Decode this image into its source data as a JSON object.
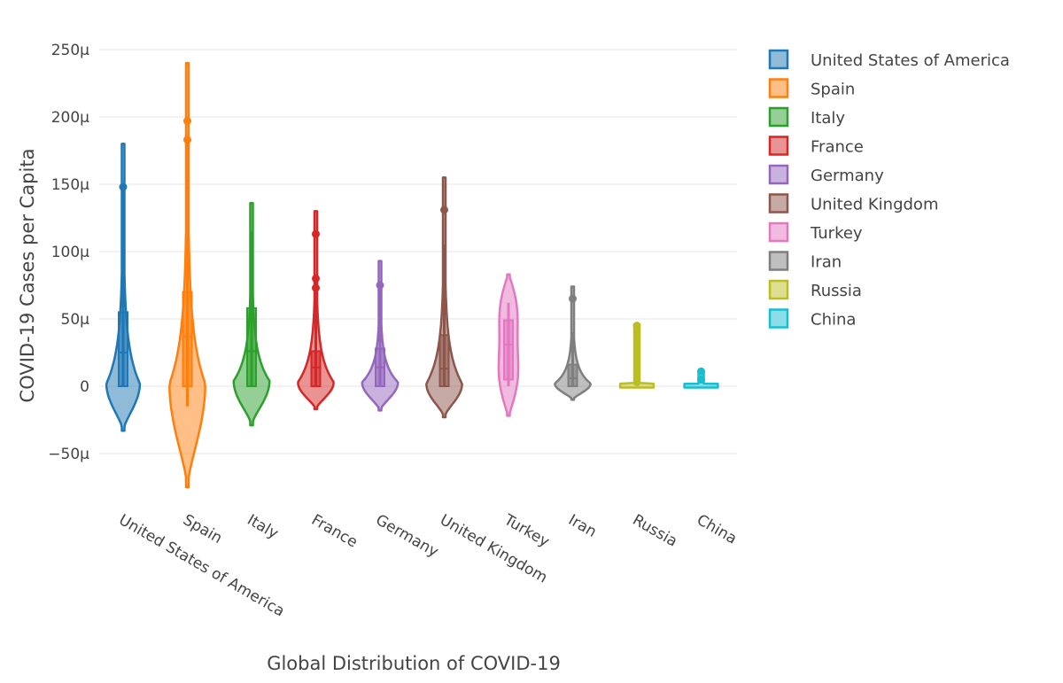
{
  "chart_data": {
    "type": "violin",
    "title": "",
    "xlabel": "Global Distribution of COVID-19",
    "ylabel": "COVID-19 Cases per Capita",
    "ylim": [
      -8e-05,
      0.000255
    ],
    "yticks": [
      {
        "value": -5e-05,
        "label": "−50μ"
      },
      {
        "value": 0,
        "label": "0"
      },
      {
        "value": 5e-05,
        "label": "50μ"
      },
      {
        "value": 0.0001,
        "label": "100μ"
      },
      {
        "value": 0.00015,
        "label": "150μ"
      },
      {
        "value": 0.0002,
        "label": "200μ"
      },
      {
        "value": 0.00025,
        "label": "250μ"
      }
    ],
    "grid": true,
    "legend_position": "top-right",
    "categories": [
      "United States of America",
      "Spain",
      "Italy",
      "France",
      "Germany",
      "United Kingdom",
      "Turkey",
      "Iran",
      "Russia",
      "China"
    ],
    "series": [
      {
        "name": "United States of America",
        "color": "#1f77b4",
        "violin_min": -3.3e-05,
        "violin_max": 0.00018,
        "q1": 0.0,
        "median": 2.5e-05,
        "q3": 5.5e-05,
        "whisker_low": 0.0,
        "whisker_high": 0.000148,
        "outliers": [
          0.000148
        ],
        "density_peak": 2e-06,
        "density_width": 0.7
      },
      {
        "name": "Spain",
        "color": "#ff7f0e",
        "violin_min": -7.5e-05,
        "violin_max": 0.00024,
        "q1": 0.0,
        "median": 3.7e-05,
        "q3": 7e-05,
        "whisker_low": -1.5e-05,
        "whisker_high": 0.000183,
        "outliers": [
          0.000197,
          0.000183
        ],
        "density_peak": 2e-06,
        "density_width": 0.75
      },
      {
        "name": "Italy",
        "color": "#2ca02c",
        "violin_min": -2.9e-05,
        "violin_max": 0.000136,
        "q1": 0.0,
        "median": 2.6e-05,
        "q3": 5.8e-05,
        "whisker_low": 0.0,
        "whisker_high": 0.000115,
        "outliers": [],
        "density_peak": 4e-06,
        "density_width": 0.75
      },
      {
        "name": "France",
        "color": "#d62728",
        "violin_min": -1.7e-05,
        "violin_max": 0.00013,
        "q1": 0.0,
        "median": 1.4e-05,
        "q3": 2.6e-05,
        "whisker_low": 0.0,
        "whisker_high": 8e-05,
        "outliers": [
          0.000113,
          8e-05,
          7.3e-05
        ],
        "density_peak": 3e-06,
        "density_width": 0.75
      },
      {
        "name": "Germany",
        "color": "#9467bd",
        "violin_min": -1.8e-05,
        "violin_max": 9.3e-05,
        "q1": 0.0,
        "median": 1.4e-05,
        "q3": 2.8e-05,
        "whisker_low": 0.0,
        "whisker_high": 7.2e-05,
        "outliers": [
          7.5e-05
        ],
        "density_peak": 3e-06,
        "density_width": 0.75
      },
      {
        "name": "United Kingdom",
        "color": "#8c564b",
        "violin_min": -2.3e-05,
        "violin_max": 0.000155,
        "q1": 0.0,
        "median": 1.3e-05,
        "q3": 3.8e-05,
        "whisker_low": 0.0,
        "whisker_high": 0.000105,
        "outliers": [
          0.000131
        ],
        "density_peak": 2e-06,
        "density_width": 0.75
      },
      {
        "name": "Turkey",
        "color": "#e377c2",
        "violin_min": -2.2e-05,
        "violin_max": 8.3e-05,
        "q1": 5e-06,
        "median": 3.1e-05,
        "q3": 4.9e-05,
        "whisker_low": 0.0,
        "whisker_high": 6.2e-05,
        "outliers": [],
        "density_peak": 3.5e-05,
        "density_width": 0.7
      },
      {
        "name": "Iran",
        "color": "#7f7f7f",
        "violin_min": -1e-05,
        "violin_max": 7.4e-05,
        "q1": 0.0,
        "median": 6e-06,
        "q3": 1.6e-05,
        "whisker_low": 0.0,
        "whisker_high": 4e-05,
        "outliers": [
          6.5e-05
        ],
        "density_peak": 2e-06,
        "density_width": 0.75
      },
      {
        "name": "Russia",
        "color": "#bcbd22",
        "violin_min": -1e-06,
        "violin_max": 4.5e-05,
        "q1": 0.0,
        "median": 0.0,
        "q3": 0.0,
        "whisker_low": 0.0,
        "whisker_high": 0.0,
        "outliers": [
          4.5e-05
        ],
        "density_peak": 0.0,
        "density_width": 0.8
      },
      {
        "name": "China",
        "color": "#17becf",
        "violin_min": -1e-06,
        "violin_max": 1.1e-05,
        "q1": 0.0,
        "median": 0.0,
        "q3": 0.0,
        "whisker_low": 0.0,
        "whisker_high": 0.0,
        "outliers": [
          1.1e-05,
          5e-06
        ],
        "density_peak": 0.0,
        "density_width": 0.75
      }
    ]
  }
}
